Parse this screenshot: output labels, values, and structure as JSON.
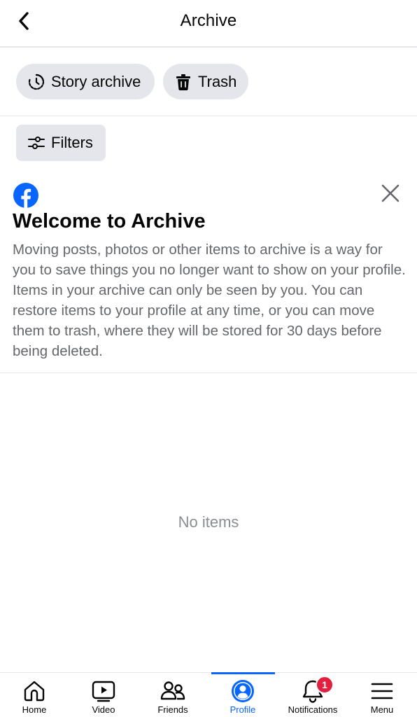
{
  "header": {
    "title": "Archive",
    "back_icon": "chevron-left-icon"
  },
  "chips": [
    {
      "label": "Story archive",
      "icon": "story-archive-icon"
    },
    {
      "label": "Trash",
      "icon": "trash-icon"
    }
  ],
  "filters": {
    "label": "Filters",
    "icon": "sliders-icon"
  },
  "welcome": {
    "logo": "facebook-logo",
    "title": "Welcome to Archive",
    "body": "Moving posts, photos or other items to archive is a way for you to save things you no longer want to show on your profile. Items in your archive can only be seen by you. You can restore items to your profile at any time, or you can move them to trash, where they will be stored for 30 days before being deleted.",
    "close_icon": "close-icon"
  },
  "empty_state": "No items",
  "colors": {
    "accent": "#0866ff",
    "chip_bg": "#e4e6eb",
    "badge": "#e41e3f",
    "secondary_text": "#65676b"
  },
  "tabbar": {
    "active": "Profile",
    "tabs": [
      {
        "label": "Home",
        "icon": "home-icon"
      },
      {
        "label": "Video",
        "icon": "video-icon"
      },
      {
        "label": "Friends",
        "icon": "friends-icon"
      },
      {
        "label": "Profile",
        "icon": "profile-icon"
      },
      {
        "label": "Notifications",
        "icon": "bell-icon",
        "badge": "1"
      },
      {
        "label": "Menu",
        "icon": "menu-icon"
      }
    ]
  }
}
